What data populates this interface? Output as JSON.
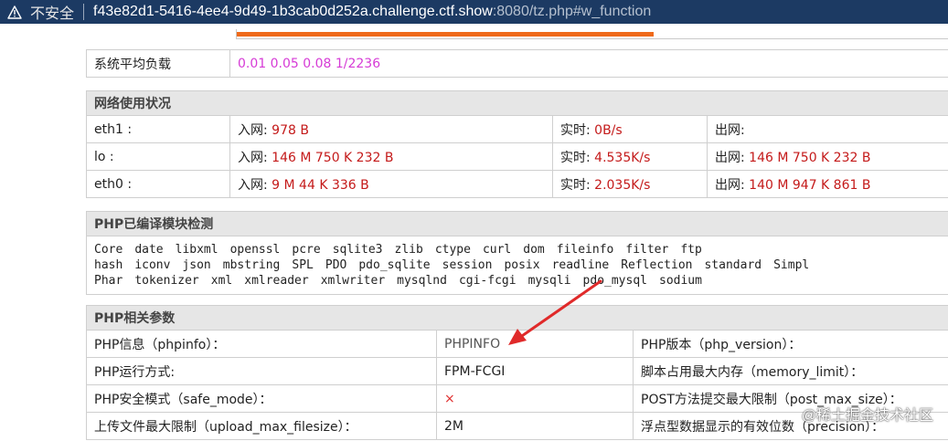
{
  "addressbar": {
    "insecure_label": "不安全",
    "url_host": "f43e82d1-5416-4ee4-9d49-1b3cab0d252a.challenge.ctf.show",
    "url_rest": ":8080/tz.php#w_function"
  },
  "load": {
    "label": "系统平均负载",
    "value": "0.01 0.05 0.08 1/2236"
  },
  "network": {
    "title": "网络使用状况",
    "in_label": "入网:",
    "realtime_label": "实时:",
    "out_label": "出网:",
    "rows": [
      {
        "iface": "eth1 :",
        "in": "978 B",
        "rt": "0B/s",
        "out": ""
      },
      {
        "iface": "lo :",
        "in": "146 M 750 K 232 B",
        "rt": "4.535K/s",
        "out": "146 M 750 K 232 B"
      },
      {
        "iface": "eth0 :",
        "in": "9 M 44 K 336 B",
        "rt": "2.035K/s",
        "out": "140 M 947 K 861 B"
      }
    ]
  },
  "modules": {
    "title": "PHP已编译模块检测",
    "rows": [
      [
        "Core",
        "date",
        "libxml",
        "openssl",
        "pcre",
        "sqlite3",
        "zlib",
        "ctype",
        "curl",
        "dom",
        "fileinfo",
        "filter",
        "ftp"
      ],
      [
        "hash",
        "iconv",
        "json",
        "mbstring",
        "SPL",
        "PDO",
        "pdo_sqlite",
        "session",
        "posix",
        "readline",
        "Reflection",
        "standard",
        "Simpl"
      ],
      [
        "Phar",
        "tokenizer",
        "xml",
        "xmlreader",
        "xmlwriter",
        "mysqlnd",
        "cgi-fcgi",
        "mysqli",
        "pdo_mysql",
        "sodium"
      ]
    ]
  },
  "params": {
    "title": "PHP相关参数",
    "rows": [
      {
        "label": "PHP信息（phpinfo）：",
        "value": "PHPINFO",
        "label2": "PHP版本（php_version）：",
        "value2": ""
      },
      {
        "label": "PHP运行方式:",
        "value": "FPM-FCGI",
        "label2": "脚本占用最大内存（memory_limit）：",
        "value2": ""
      },
      {
        "label": "PHP安全模式（safe_mode）：",
        "value": "×",
        "label2": "POST方法提交最大限制（post_max_size）：",
        "value2": ""
      },
      {
        "label": "上传文件最大限制（upload_max_filesize）：",
        "value": "2M",
        "label2": "浮点型数据显示的有效位数（precision）：",
        "value2": ""
      }
    ]
  },
  "watermark": "@稀土掘金技术社区",
  "colors": {
    "address_bg": "#1c3a63",
    "section_bg": "#e6e6e6",
    "pink_value": "#d63bd6",
    "red_value": "#c41a1a",
    "progress_fill": "#ef6a1a",
    "annotation_arrow": "#e02a2a"
  }
}
